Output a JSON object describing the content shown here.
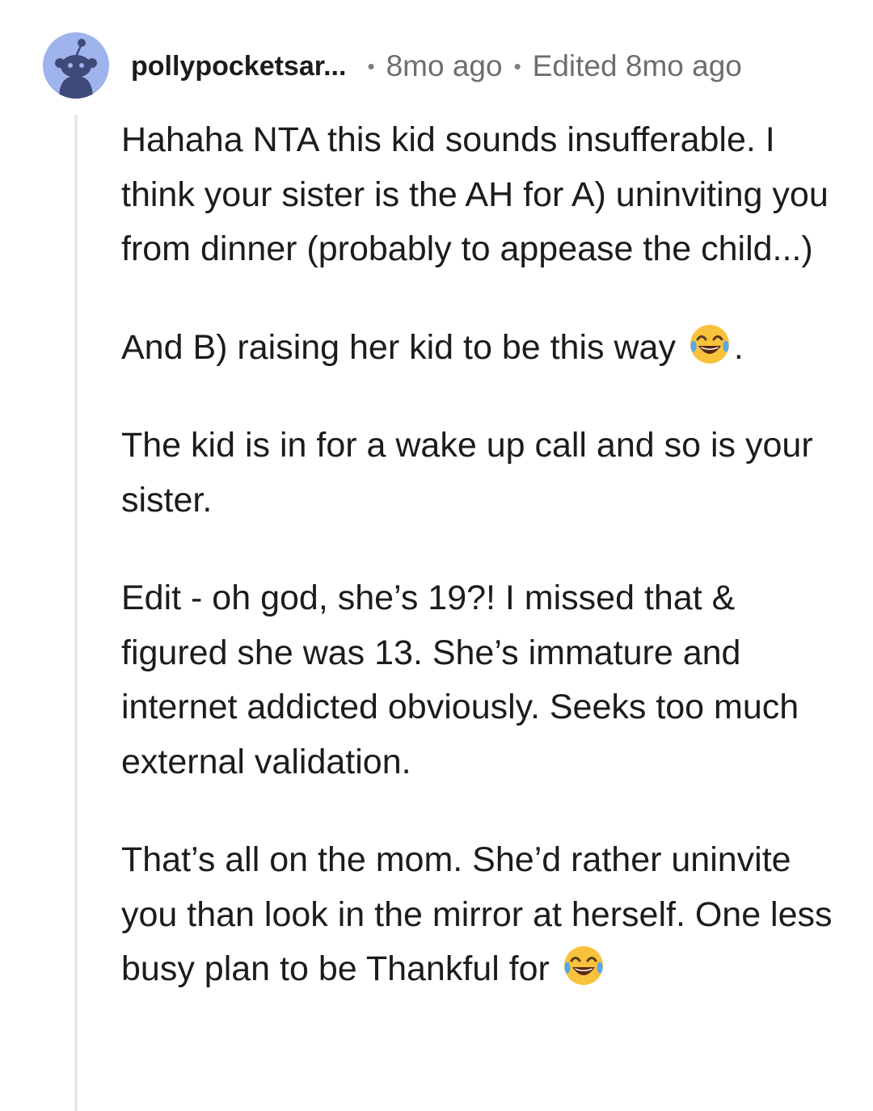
{
  "comment": {
    "username": "pollypocketsar...",
    "separator": "•",
    "posted": "8mo ago",
    "edited": "Edited 8mo ago",
    "avatar_icon": "snoo-avatar-icon",
    "paragraphs": [
      {
        "text": "Hahaha NTA this kid sounds insufferable. I think your sister is the AH for A) uninviting you from dinner (probably to appease the child...)",
        "suffix": ""
      },
      {
        "text": "And B) raising her kid to be this way ",
        "emoji": "face-with-tears-of-joy-icon",
        "suffix": "."
      },
      {
        "text": "The kid is in for a wake up call and so is your sister.",
        "suffix": ""
      },
      {
        "text": "Edit - oh god, she’s 19?! I missed that & figured she was 13. She’s immature and internet addicted obviously. Seeks too much external validation.",
        "suffix": ""
      },
      {
        "text": "That’s all on the mom. She’d rather uninvite you than look in the mirror at herself. One less busy plan to be Thankful for ",
        "emoji": "face-with-tears-of-joy-icon",
        "suffix": ""
      }
    ]
  },
  "colors": {
    "avatar_bg": "#9fb3ec",
    "snoo": "#3d4a7a",
    "text": "#1c1c1c",
    "meta_text": "#6b6f73",
    "thread_line": "#e6e8ea",
    "emoji_face": "#f9c23c"
  }
}
